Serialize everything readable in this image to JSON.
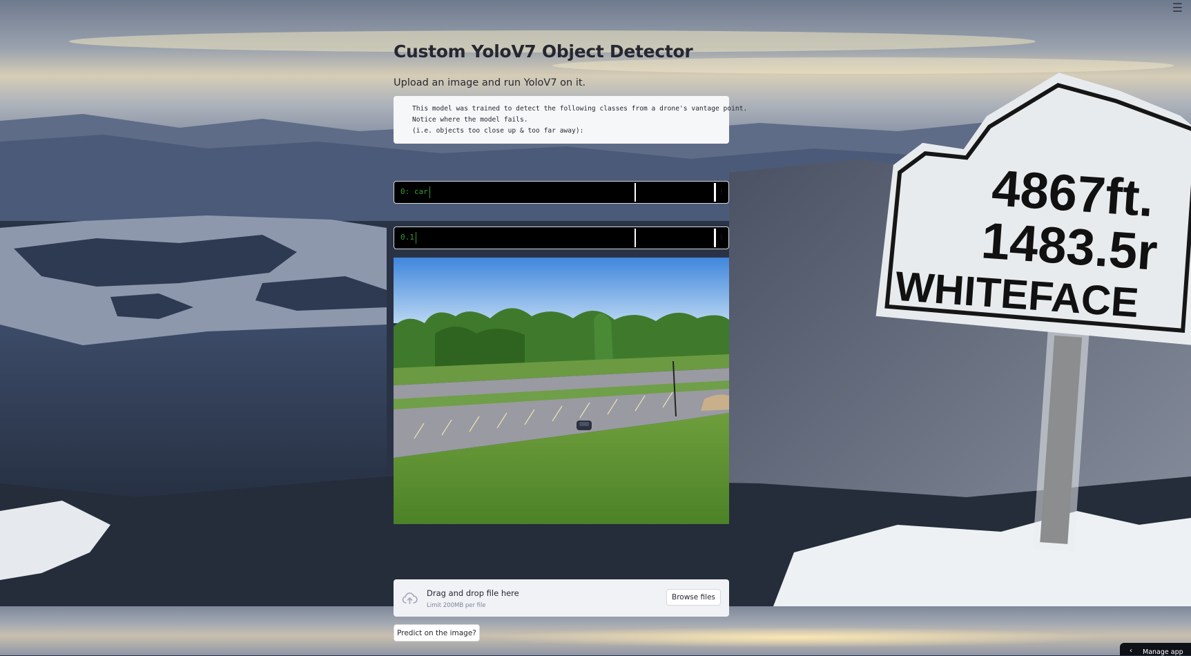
{
  "header": {
    "menu_icon": "hamburger-menu-icon"
  },
  "page": {
    "title": "Custom YoloV7 Object Detector",
    "subtitle": "Upload an image and run YoloV7 on it.",
    "code_lines": [
      "This model was trained to detect the following classes from a drone's vantage point.",
      "Notice where the model fails.",
      "(i.e. objects too close up & too far away):"
    ]
  },
  "class_area": {
    "value": "0: car"
  },
  "confidence_area": {
    "value": "0.1"
  },
  "background": {
    "sign_lines": [
      "4867ft.",
      "1483.5r",
      "WHITEFACE"
    ]
  },
  "uploader": {
    "icon": "cloud-upload-icon",
    "drag_text": "Drag and drop file here",
    "limit_text": "Limit 200MB per file",
    "browse_label": "Browse files"
  },
  "actions": {
    "predict_label": "Predict on the image?"
  },
  "footer": {
    "manage_label": "Manage app",
    "manage_icon": "chevron-left-icon"
  }
}
